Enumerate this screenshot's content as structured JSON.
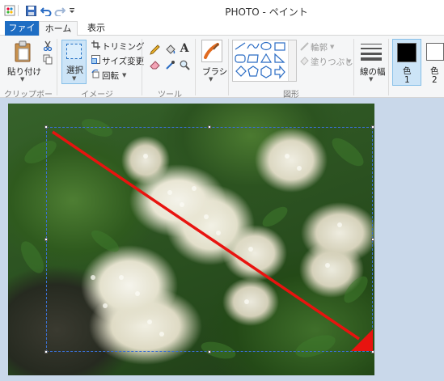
{
  "window": {
    "title": "PHOTO - ペイント"
  },
  "quick_access": {
    "icons": [
      "paint-app-icon",
      "save-icon",
      "undo-icon",
      "redo-icon",
      "customize-dropdown-icon"
    ]
  },
  "tabs": [
    {
      "label": "ファイル",
      "active": false,
      "highlight": true
    },
    {
      "label": "ホーム",
      "active": true
    },
    {
      "label": "表示",
      "active": false
    }
  ],
  "ribbon": {
    "clipboard": {
      "paste_label": "貼り付け",
      "group_label": "クリップボード"
    },
    "image": {
      "select_label": "選択",
      "trim_label": "トリミング",
      "resize_label": "サイズ変更",
      "rotate_label": "回転",
      "group_label": "イメージ"
    },
    "tools": {
      "group_label": "ツール"
    },
    "brush": {
      "label": "ブラシ"
    },
    "shapes": {
      "outline_label": "輪郭",
      "fill_label": "塗りつぶし",
      "group_label": "図形"
    },
    "size": {
      "label": "線の幅"
    },
    "colors": {
      "color1_label": "色",
      "color1_num": "1",
      "color2_label": "色",
      "color2_num": "2",
      "color1_value": "#000000",
      "color2_value": "#ffffff"
    }
  },
  "canvas": {
    "arrow_color": "#e8130f"
  }
}
